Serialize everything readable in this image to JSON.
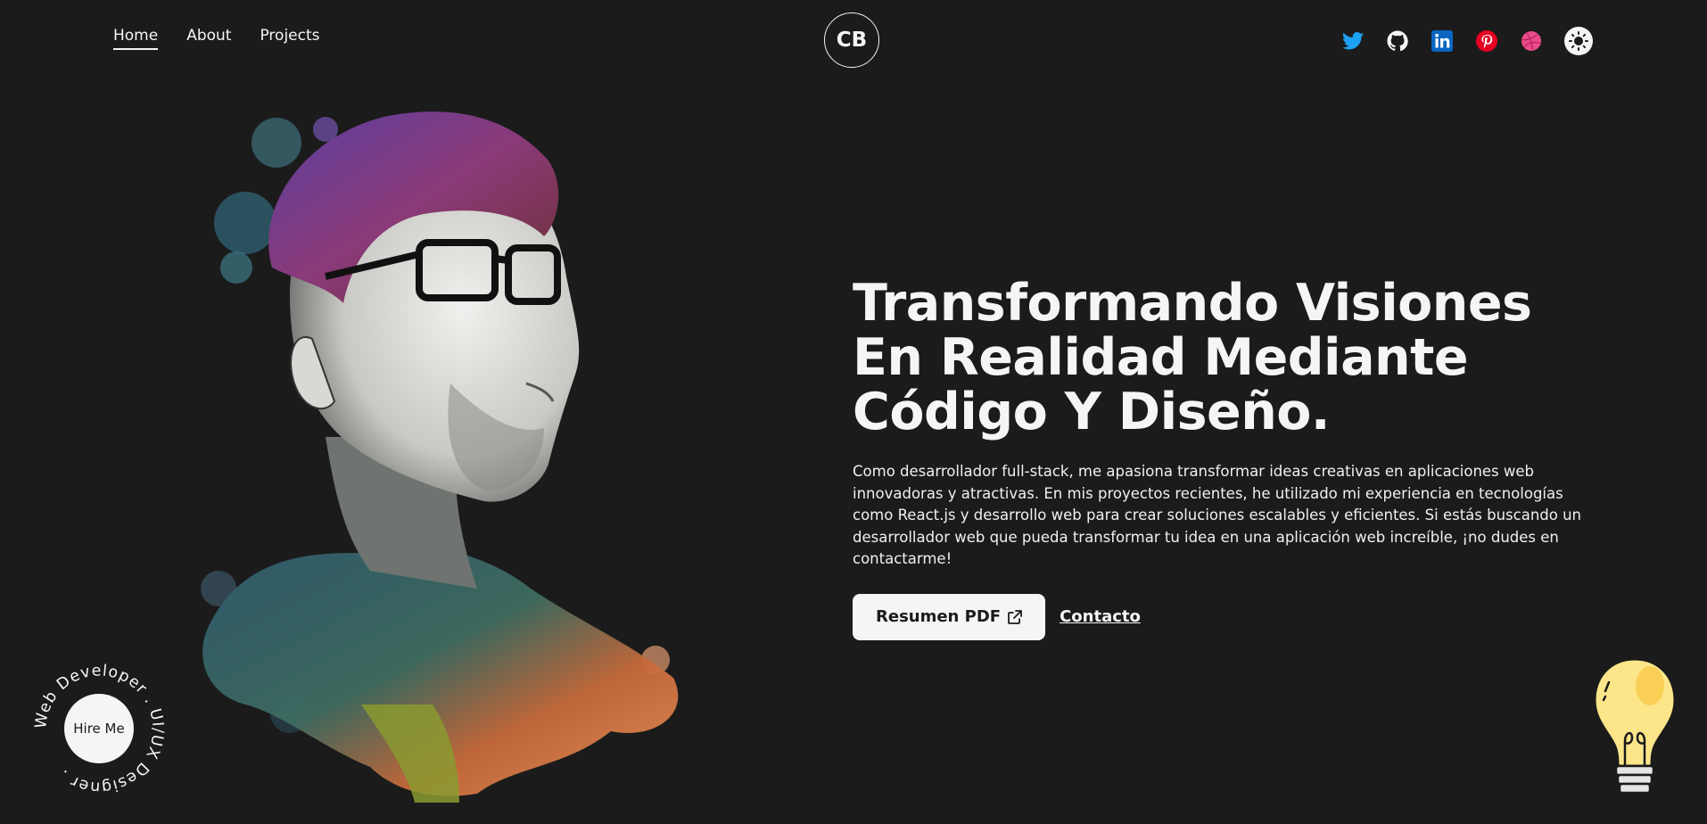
{
  "nav": {
    "items": [
      {
        "label": "Home",
        "active": true
      },
      {
        "label": "About",
        "active": false
      },
      {
        "label": "Projects",
        "active": false
      }
    ]
  },
  "logo": {
    "text": "CB"
  },
  "social": {
    "icons": [
      "twitter-icon",
      "github-icon",
      "linkedin-icon",
      "pinterest-icon",
      "dribbble-icon"
    ],
    "theme_toggle_icon": "sun-icon"
  },
  "hero": {
    "headline_line1": "Transformando Visiones",
    "headline_line2": "En Realidad Mediante",
    "headline_line3": "Código Y Diseño.",
    "description": "Como desarrollador full-stack, me apasiona transformar ideas creativas en aplicaciones web innovadoras y atractivas. En mis proyectos recientes, he utilizado mi experiencia en tecnologías como React.js y desarrollo web para crear soluciones escalables y eficientes. Si estás buscando un desarrollador web que pueda transformar tu idea en una aplicación web increíble, ¡no dudes en contactarme!",
    "resume_button": "Resumen PDF",
    "contact_link": "Contacto"
  },
  "hire": {
    "button": "Hire Me",
    "ring_text": "Web Developer . UI/UX Designer ."
  },
  "colors": {
    "background": "#1b1b1b",
    "foreground": "#f5f5f5",
    "twitter": "#1da1f2",
    "linkedin": "#0a66c2",
    "pinterest": "#e60023",
    "dribbble": "#ea4c89"
  }
}
